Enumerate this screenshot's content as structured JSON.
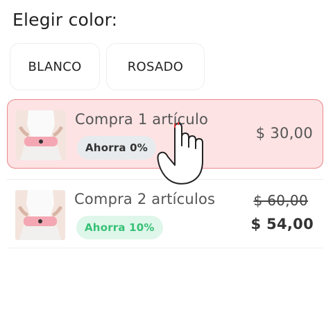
{
  "heading": "Elegir color:",
  "color_options": [
    {
      "label": "BLANCO"
    },
    {
      "label": "ROSADO"
    }
  ],
  "offers": [
    {
      "name": "Compra 1 artículo",
      "badge": "Ahorra 0%",
      "price": "$ 30,00",
      "selected": true
    },
    {
      "name": "Compra 2 artículos",
      "badge": "Ahorra 10%",
      "old_price": "$ 60,00",
      "price": "$ 54,00",
      "selected": false
    }
  ],
  "colors": {
    "selected_bg": "#fde3e4",
    "selected_border": "#e9878b",
    "save_badge_green": "#37c176",
    "save_badge_green_bg": "#dff6ea"
  },
  "icons": {
    "pointer": "hand-pointer-icon",
    "product": "pink-waist-belt-product-image"
  }
}
